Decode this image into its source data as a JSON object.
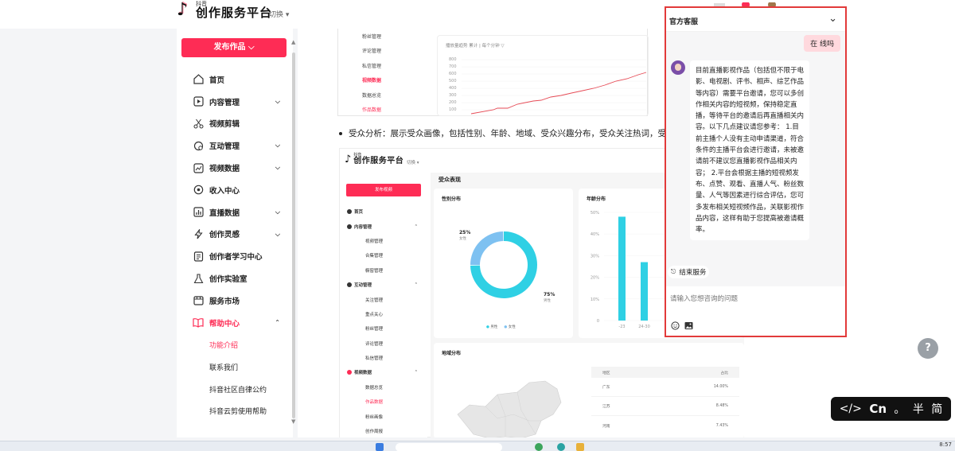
{
  "header": {
    "logo_small": "抖音",
    "logo_big": "创作服务平台",
    "switch_label": "切换"
  },
  "sidebar": {
    "publish_label": "发布作品",
    "items": [
      {
        "label": "首页",
        "icon": "home-icon",
        "chevron": false
      },
      {
        "label": "内容管理",
        "icon": "play-square-icon",
        "chevron": true
      },
      {
        "label": "视频剪辑",
        "icon": "scissors-icon",
        "chevron": false
      },
      {
        "label": "互动管理",
        "icon": "chat-icon",
        "chevron": true
      },
      {
        "label": "视频数据",
        "icon": "chart-icon",
        "chevron": true
      },
      {
        "label": "收入中心",
        "icon": "coin-icon",
        "chevron": false
      },
      {
        "label": "直播数据",
        "icon": "bar-chart-icon",
        "chevron": true
      },
      {
        "label": "创作灵感",
        "icon": "bolt-icon",
        "chevron": true
      },
      {
        "label": "创作者学习中心",
        "icon": "document-icon",
        "chevron": false
      },
      {
        "label": "创作实验室",
        "icon": "flask-icon",
        "chevron": false
      },
      {
        "label": "服务市场",
        "icon": "store-icon",
        "chevron": false
      },
      {
        "label": "帮助中心",
        "icon": "book-icon",
        "chevron": true,
        "active": true
      }
    ],
    "sub_items": [
      {
        "label": "功能介绍",
        "active": true
      },
      {
        "label": "联系我们",
        "active": false
      },
      {
        "label": "抖音社区自律公约",
        "active": false
      },
      {
        "label": "抖音云剪使用帮助",
        "active": false
      }
    ]
  },
  "doc": {
    "shot1": {
      "menu": [
        "粉丝管理",
        "评论管理",
        "私信管理",
        "视频数据",
        "数据总览",
        "作品数据"
      ],
      "chart_title": "播放量趋势  累计 | 每个分钟  ▽",
      "y_ticks": [
        "800",
        "700",
        "600",
        "500",
        "400",
        "300",
        "200",
        "100"
      ]
    },
    "bullet": "受众分析：展示受众画像，包括性别、年龄、地域、受众兴趣分布，受众关注热词，受众",
    "shot2": {
      "logo_small": "抖音",
      "logo_big": "创作服务平台",
      "switch": "切换",
      "publish": "发布视频",
      "nav": [
        {
          "label": "首页",
          "type": "h"
        },
        {
          "label": "内容管理",
          "type": "h",
          "arrow": "⌃"
        },
        {
          "label": "视频管理",
          "type": "s"
        },
        {
          "label": "合集管理",
          "type": "s"
        },
        {
          "label": "橱窗管理",
          "type": "s"
        },
        {
          "label": "互动管理",
          "type": "h",
          "arrow": "⌃"
        },
        {
          "label": "关注管理",
          "type": "s"
        },
        {
          "label": "重点关心",
          "type": "s"
        },
        {
          "label": "粉丝管理",
          "type": "s"
        },
        {
          "label": "评论管理",
          "type": "s"
        },
        {
          "label": "私信管理",
          "type": "s"
        },
        {
          "label": "视频数据",
          "type": "h",
          "arrow": "⌃",
          "red": true
        },
        {
          "label": "数据总览",
          "type": "s"
        },
        {
          "label": "作品数据",
          "type": "s",
          "active": true
        },
        {
          "label": "粉丝画像",
          "type": "s"
        },
        {
          "label": "创作周报",
          "type": "s"
        }
      ],
      "section_title": "受众表现",
      "gender_title": "性别分布",
      "gender_female_pct": "25%",
      "gender_female_label": "女性",
      "gender_male_pct": "75%",
      "gender_male_label": "男性",
      "gender_legend_male": "男性",
      "gender_legend_female": "女性",
      "age_title": "年龄分布",
      "age_y_ticks": [
        "50%",
        "40%",
        "30%",
        "20%",
        "10%",
        "0"
      ],
      "age_x_ticks": [
        "-23",
        "24-30"
      ],
      "region_title": "地域分布",
      "region_table_head": [
        "地区",
        "占比"
      ],
      "region_rows": [
        {
          "name": "广东",
          "value": "14.00%"
        },
        {
          "name": "江苏",
          "value": "8.48%"
        },
        {
          "name": "河南",
          "value": "7.43%"
        }
      ]
    }
  },
  "chart_data": [
    {
      "type": "pie",
      "title": "性别分布",
      "categories": [
        "男性",
        "女性"
      ],
      "values": [
        75,
        25
      ]
    },
    {
      "type": "bar",
      "title": "年龄分布",
      "categories": [
        "-23",
        "24-30"
      ],
      "series": [
        {
          "values": [
            48,
            27
          ]
        }
      ],
      "ylim": [
        0,
        50
      ]
    }
  ],
  "chat": {
    "title": "官方客服",
    "user_message": "在 线吗",
    "bot_message": "目前直播影视作品（包括但不限于电影、电视剧、评书、相声、综艺作品等内容）需要平台邀请，您可以多创作相关内容的短视频，保持稳定直播，等待平台的邀请后再直播相关内容。以下几点建议请您参考： 1.目前主播个人没有主动申请渠道，符合条件的主播平台会进行邀请，未被邀请前不建议您直播影视作品相关内容； 2.平台会根据主播的短视频发布、点赞、观看、直播人气、粉丝数量、人气等因素进行综合评估，您可多发布相关短视频作品，关联影视作品内容，这样有助于您提高被邀请概率。",
    "end_service": "结束服务",
    "input_placeholder": "请输入您想咨询的问题"
  },
  "ime": {
    "code_icon": "</>",
    "lang": "Cn",
    "punct": "。",
    "width": "半",
    "script": "简"
  },
  "taskbar": {
    "time": "8:57"
  },
  "colors": {
    "brand": "#fe2c55",
    "chat_border": "#e23a3a",
    "donut_male": "#2fd0e4",
    "donut_female": "#7ec1f1"
  }
}
